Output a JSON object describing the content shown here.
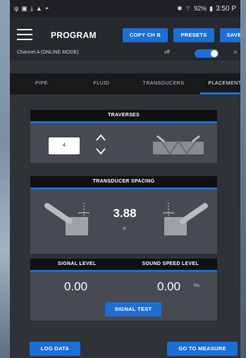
{
  "status_bar": {
    "left_icons": [
      "usb-icon",
      "gallery-icon",
      "download-icon",
      "warning-icon",
      "android-icon"
    ],
    "battery": "92%",
    "time": "3:50 P"
  },
  "app_bar": {
    "title": "PROGRAM",
    "copy_label": "COPY CH B",
    "presets_label": "PRESETS",
    "save_label": "SAVE"
  },
  "channel": {
    "label": "Channel A (ONLINE MODE)",
    "off_label": "off",
    "on_label": "o",
    "toggle_on": true
  },
  "tabs": [
    {
      "label": "PIPE"
    },
    {
      "label": "FLUID"
    },
    {
      "label": "TRANSDUCERS"
    },
    {
      "label": "PLACEMENT"
    }
  ],
  "active_tab": "PLACEMENT",
  "traverses": {
    "title": "TRAVERSES",
    "value": "4"
  },
  "spacing": {
    "title": "TRANSDUCER SPACING",
    "value": "3.88",
    "unit": "in"
  },
  "levels": {
    "signal_title": "SIGNAL LEVEL",
    "sound_title": "SOUND SPEED LEVEL",
    "signal_value": "0.00",
    "sound_value": "0.00",
    "sound_unit": "ft/s",
    "signal_test_label": "SIGNAL TEST"
  },
  "footer": {
    "log_label": "LOG DATA",
    "measure_label": "GO TO MEASURE"
  },
  "colors": {
    "accent": "#1c6fd6",
    "background": "#2f3237",
    "card": "#474b51"
  }
}
